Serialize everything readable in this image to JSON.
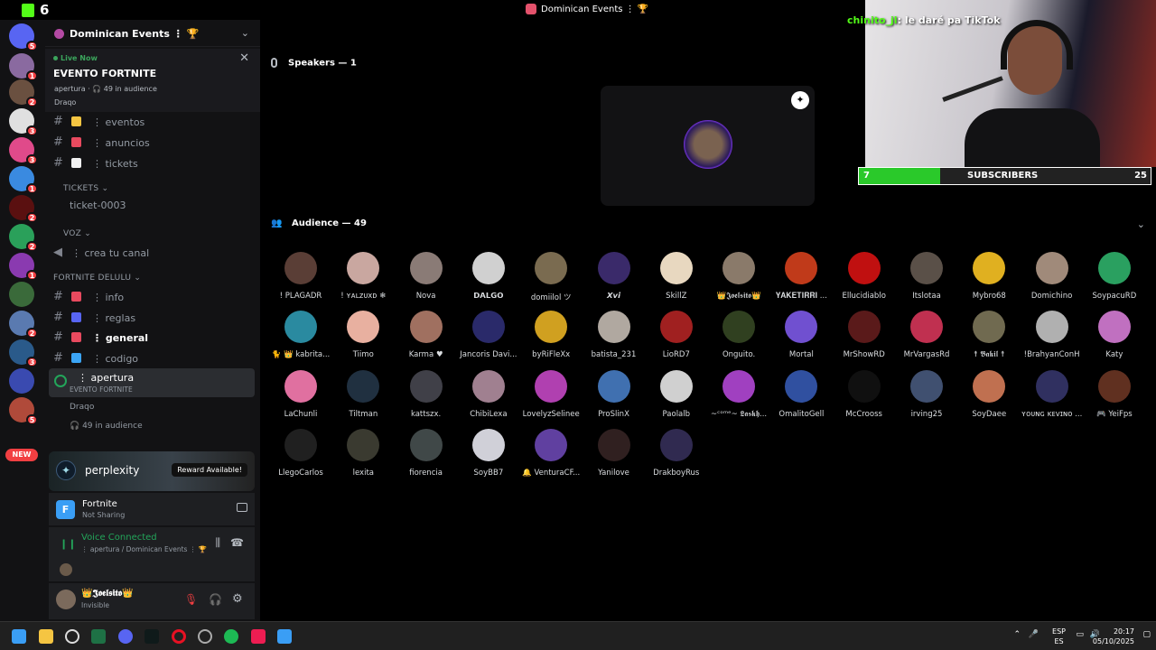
{
  "kick": {
    "count": "6"
  },
  "window": {
    "title": "Dominican Events ⋮ 🏆"
  },
  "guild_badges": [
    "5",
    "1",
    "2",
    "3",
    "3",
    "1",
    "2",
    "2",
    "1",
    "",
    "2",
    "3",
    "",
    "5"
  ],
  "guild_new": "NEW",
  "server": {
    "name": "Dominican Events ⋮ 🏆",
    "chevron": "⌄"
  },
  "live": {
    "tag": "Live Now",
    "event": "EVENTO FORTNITE",
    "meta": "apertura · 🎧 49 in audience",
    "host": "Draqo",
    "close": "✕"
  },
  "channels": [
    {
      "emoji_color": "#f5c542",
      "label": "⋮ eventos"
    },
    {
      "emoji_color": "#e84a5f",
      "label": "⋮ anuncios"
    },
    {
      "emoji_color": "#f0f0f0",
      "label": "⋮ tickets"
    }
  ],
  "cat_tickets": "TICKETS ⌄",
  "ticket": "ticket-0003",
  "cat_voz": "VOZ ⌄",
  "voz_channel": "⋮ crea tu canal",
  "cat_fortnite": "FORTNITE DELULU ⌄",
  "fortnite_channels": [
    {
      "emoji_color": "#e84a5f",
      "label": "⋮ info",
      "bold": false
    },
    {
      "emoji_color": "#5865f2",
      "label": "⋮ reglas",
      "bold": false
    },
    {
      "emoji_color": "#e84a5f",
      "label": "⋮ general",
      "bold": true
    },
    {
      "emoji_color": "#3ba5f5",
      "label": "⋮ codigo",
      "bold": false
    }
  ],
  "voice_channel": {
    "name": "⋮ apertura",
    "sub": "EVENTO FORTNITE"
  },
  "voice_host": "Draqo",
  "voice_aud": "🎧 49 in audience",
  "promo": {
    "name": "perplexity",
    "reward": "Reward Available!"
  },
  "activity": {
    "title": "Fortnite",
    "sub": "Not Sharing",
    "icon": "F"
  },
  "voicecon": {
    "status": "Voice Connected",
    "sub": "⋮ apertura / Dominican Events ⋮ 🏆"
  },
  "user": {
    "name": "👑𝕵𝖔𝖊𝖑𝖘𝖎𝖙𝖔👑",
    "status": "Invisible"
  },
  "speakers": {
    "header": "Speakers — 1"
  },
  "audience": {
    "header": "Audience — 49"
  },
  "members": [
    {
      "name": "! PLAGADR",
      "c": "#5a3e36"
    },
    {
      "name": "! ʏᴀʟᴢᴜxᴅ ❄",
      "c": "#c9a7a0"
    },
    {
      "name": "Nova",
      "c": "#8a7b76"
    },
    {
      "name": "𝗗𝗔𝗟𝗚𝗢",
      "c": "#d0d0d0"
    },
    {
      "name": "domiilol ツ",
      "c": "#7a6b50"
    },
    {
      "name": "𝙓𝙫𝙞",
      "c": "#3a2a6a"
    },
    {
      "name": "SkillZ",
      "c": "#e8d8c0"
    },
    {
      "name": "👑𝕵𝖔𝖊𝖑𝖘𝖎𝖙𝖔👑",
      "c": "#8a7a6a"
    },
    {
      "name": "𝐘𝐀𝐊𝐄𝐓𝐈𝐑𝐑𝐈 ...",
      "c": "#c03a1a"
    },
    {
      "name": "Ellucidiablo",
      "c": "#c01010"
    },
    {
      "name": "Itslotaa",
      "c": "#5a5048"
    },
    {
      "name": "Mybro68",
      "c": "#e0b020"
    },
    {
      "name": "Domichino",
      "c": "#a08a7a"
    },
    {
      "name": "SoypacuRD",
      "c": "#2aa060"
    },
    {
      "name": "🐈 👑 kabrita...",
      "c": "#2a8aa0"
    },
    {
      "name": "Tiimo",
      "c": "#e8b0a0"
    },
    {
      "name": "Karma ♥",
      "c": "#a07060"
    },
    {
      "name": "Jancoris Davi...",
      "c": "#2a2a6a"
    },
    {
      "name": "byRiFleXx",
      "c": "#d0a020"
    },
    {
      "name": "batista_231",
      "c": "#b0a8a0"
    },
    {
      "name": "LioRD7",
      "c": "#a02020"
    },
    {
      "name": "Onguito.",
      "c": "#304020"
    },
    {
      "name": "Mortal",
      "c": "#7050d0"
    },
    {
      "name": "MrShowRD",
      "c": "#5a1a1a"
    },
    {
      "name": "MrVargasRd",
      "c": "#c03050"
    },
    {
      "name": "☨ 𝕭𝖆𝖐𝖎𝖑 ☨",
      "c": "#706a50"
    },
    {
      "name": "!BrahyanConH",
      "c": "#b0b0b0"
    },
    {
      "name": "Katy",
      "c": "#c070c0"
    },
    {
      "name": "LaChunli",
      "c": "#e070a0"
    },
    {
      "name": "Tiltman",
      "c": "#203040"
    },
    {
      "name": "kattszx.",
      "c": "#404048"
    },
    {
      "name": "ChibiLexa",
      "c": "#a08090"
    },
    {
      "name": "LovelyzSelinee",
      "c": "#b040b0"
    },
    {
      "name": "ProSlinX",
      "c": "#4070b0"
    },
    {
      "name": "Paolalb",
      "c": "#d0d0d0"
    },
    {
      "name": "~ᶜᵒᵐᵉ~ 𝕷𝖆𝖘𝖐𝖍...",
      "c": "#a040c0"
    },
    {
      "name": "OmalitoGell",
      "c": "#3050a0"
    },
    {
      "name": "McCrooss",
      "c": "#101010"
    },
    {
      "name": "irving25",
      "c": "#405070"
    },
    {
      "name": "SoyDaee",
      "c": "#c07050"
    },
    {
      "name": "ʏᴏᴜɴɢ ᴋᴇᴠɪɴᴏ ...",
      "c": "#303060"
    },
    {
      "name": "🎮 YeiFps",
      "c": "#603020"
    },
    {
      "name": "LlegoCarlos",
      "c": "#202020"
    },
    {
      "name": "lexita",
      "c": "#3a3a30"
    },
    {
      "name": "fiorencia",
      "c": "#404848"
    },
    {
      "name": "SoyBB7",
      "c": "#d0d0d8"
    },
    {
      "name": "🔔 VenturaCF...",
      "c": "#6040a0"
    },
    {
      "name": "Yanilove",
      "c": "#302020"
    },
    {
      "name": "DrakboyRus",
      "c": "#302a50"
    }
  ],
  "stream_chat": {
    "user": "chinito_jl",
    "msg": ": le daré pa TikTok"
  },
  "subgoal": {
    "current": "7",
    "label": "SUBSCRIBERS",
    "goal": "25",
    "progress": 0.28
  },
  "tray": {
    "lang1": "ESP",
    "lang2": "ES",
    "time": "20:17",
    "date": "05/10/2025"
  },
  "colors": {
    "accent": "#53fc18",
    "discord_red": "#f23f42",
    "voice_green": "#23a55a"
  }
}
